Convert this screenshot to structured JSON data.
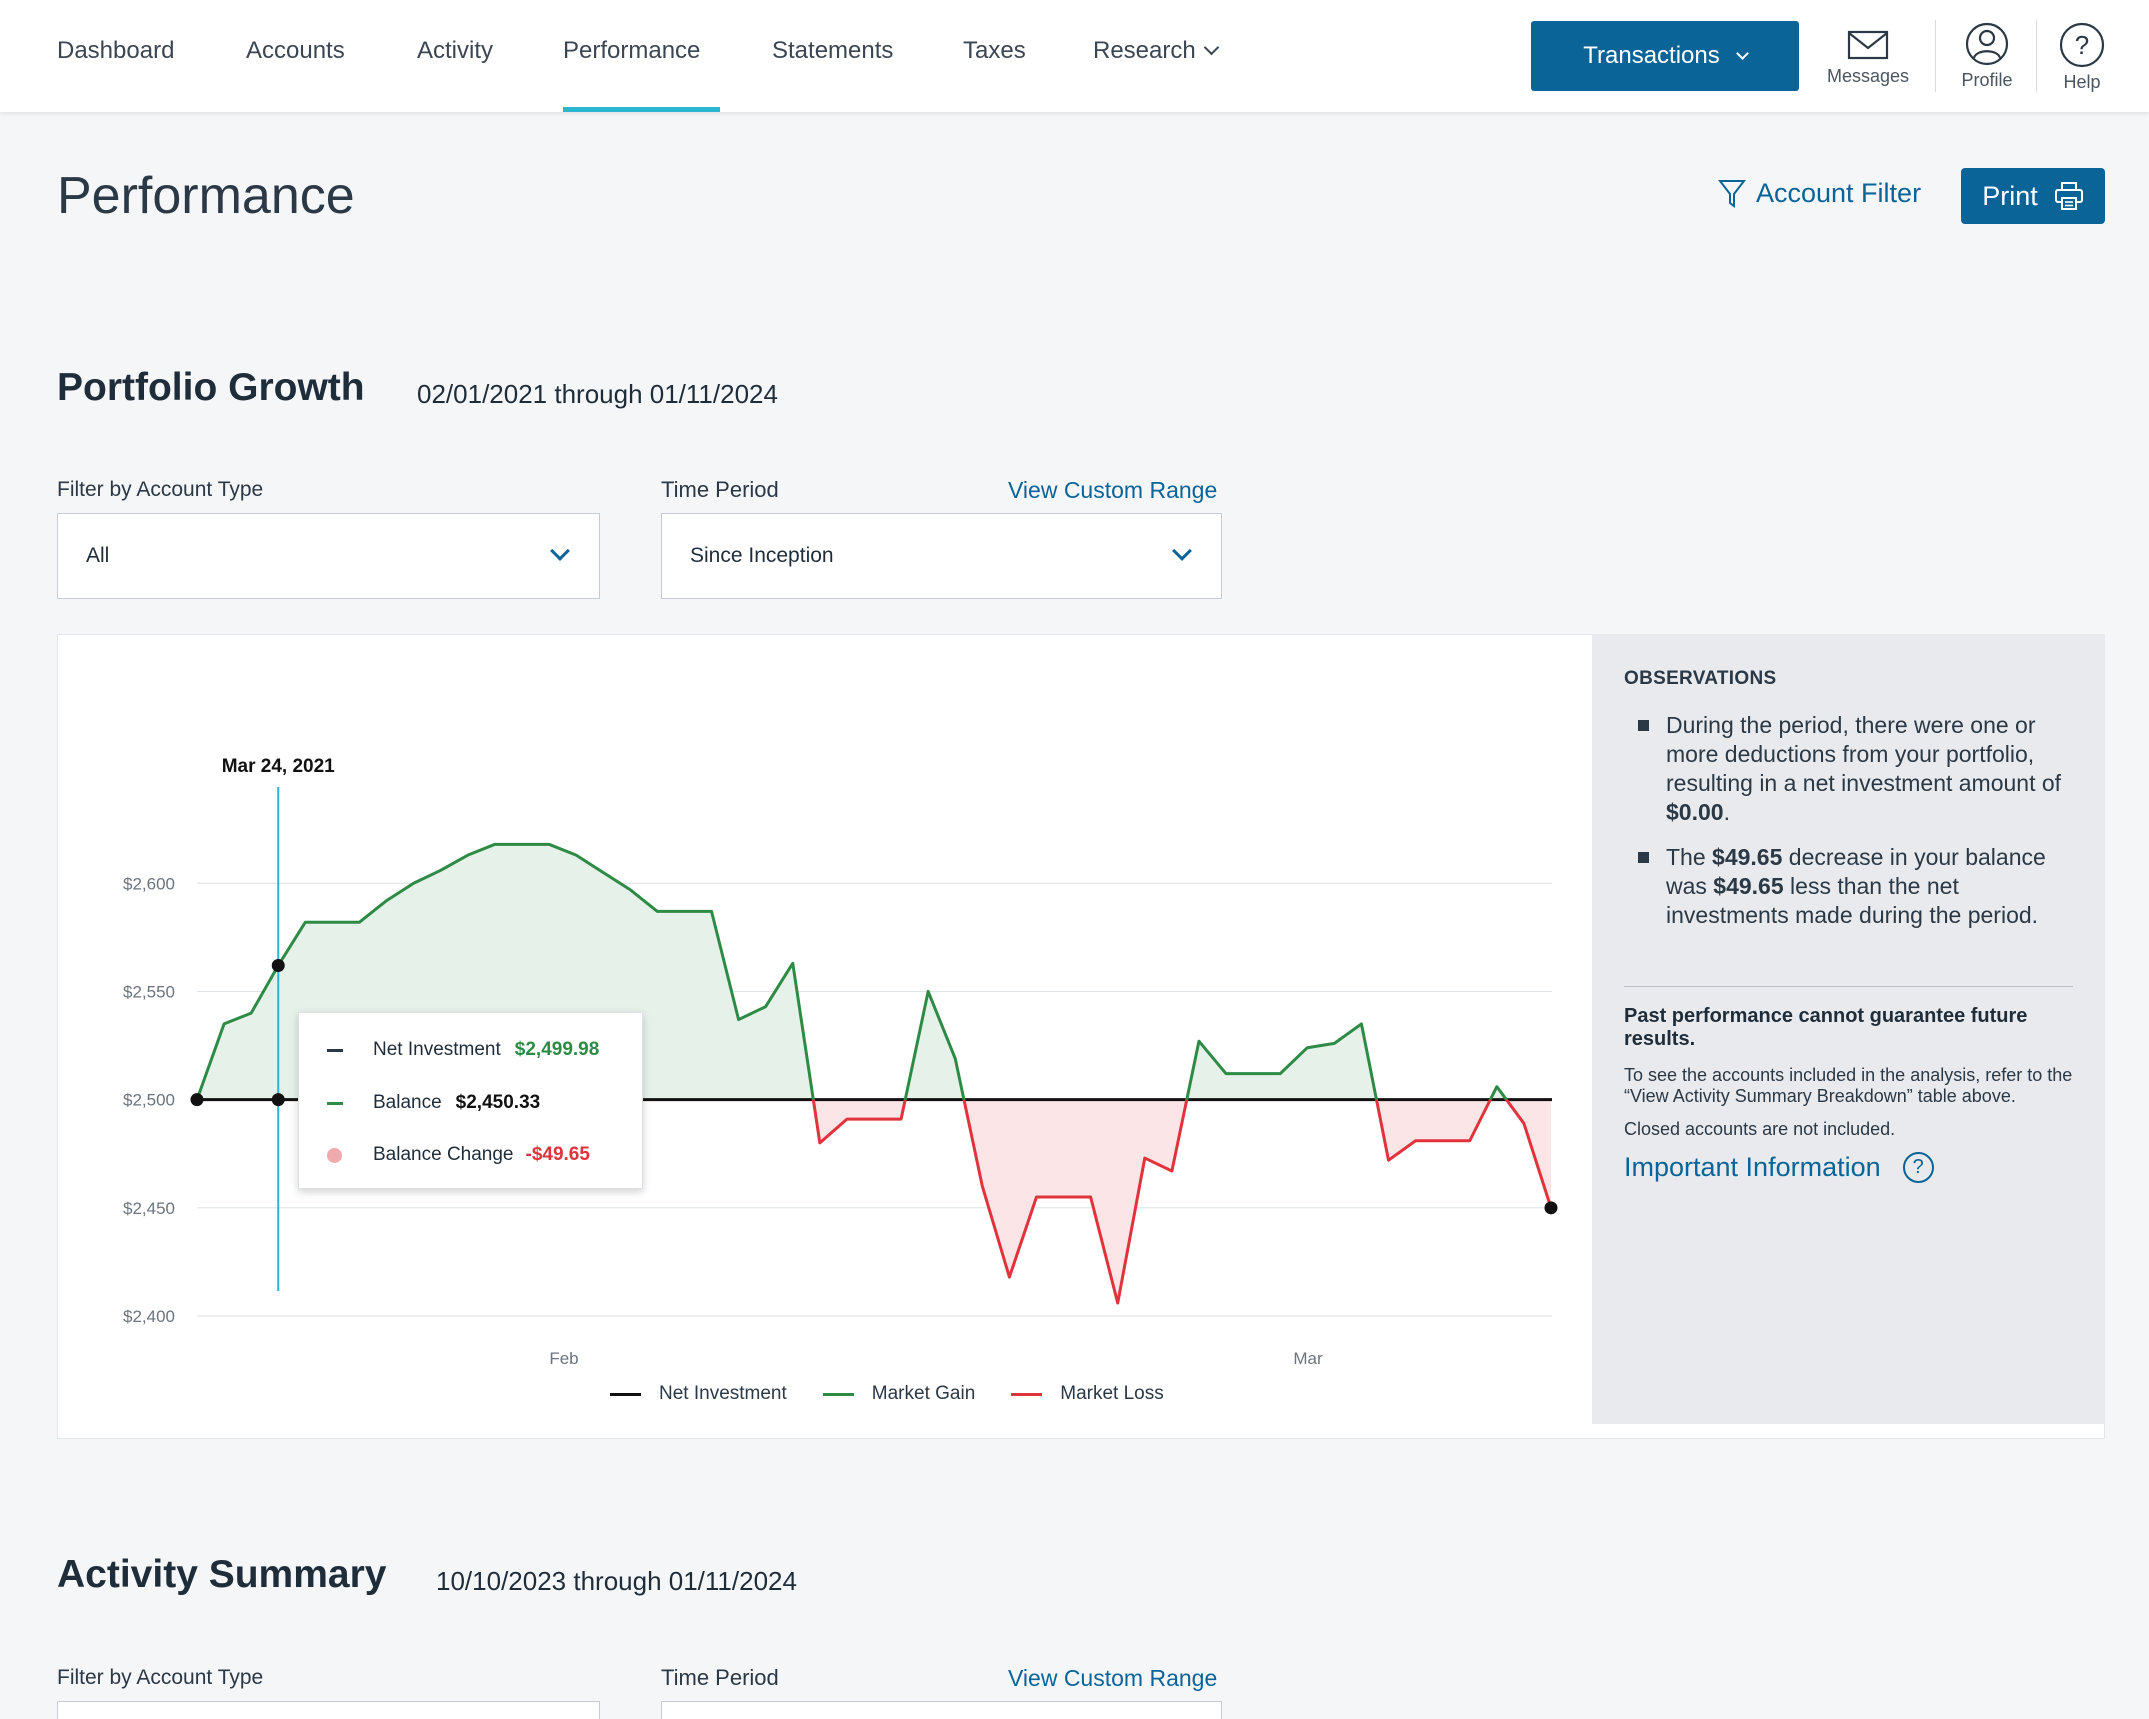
{
  "nav": {
    "tabs": [
      {
        "label": "Dashboard"
      },
      {
        "label": "Accounts"
      },
      {
        "label": "Activity"
      },
      {
        "label": "Performance"
      },
      {
        "label": "Statements"
      },
      {
        "label": "Taxes"
      },
      {
        "label": "Research"
      }
    ],
    "active_tab": "Performance",
    "transactions_label": "Transactions",
    "messages_label": "Messages",
    "profile_label": "Profile",
    "help_label": "Help"
  },
  "page": {
    "title": "Performance",
    "account_filter_label": "Account Filter",
    "print_label": "Print"
  },
  "portfolio_growth": {
    "title": "Portfolio Growth",
    "date_range": "02/01/2021 through 01/11/2024",
    "filter_label": "Filter by Account Type",
    "filter_value": "All",
    "period_label": "Time Period",
    "period_value": "Since Inception",
    "custom_range_link": "View Custom Range"
  },
  "tooltip": {
    "date": "Mar 24, 2021",
    "net_label": "Net Investment",
    "net_value": "$2,499.98",
    "balance_label": "Balance",
    "balance_value": "$2,450.33",
    "change_label": "Balance Change",
    "change_value": "-$49.65"
  },
  "colors": {
    "gain": "#2e8b45",
    "loss": "#e0333b",
    "net": "#111111",
    "accent": "#0a6497",
    "cursor": "#2ab5d1"
  },
  "chart_data": {
    "type": "area",
    "y_ticks": [
      "$2,600",
      "$2,550",
      "$2,500",
      "$2,450",
      "$2,400"
    ],
    "ylim": [
      2400,
      2620
    ],
    "x_ticks": [
      "Feb",
      "Mar"
    ],
    "net_investment": 2500,
    "balance": [
      2500,
      2535,
      2540,
      2562,
      2582,
      2582,
      2582,
      2592,
      2600,
      2606,
      2613,
      2618,
      2618,
      2618,
      2613,
      2605,
      2597,
      2587,
      2587,
      2587,
      2537,
      2543,
      2563,
      2480,
      2491,
      2491,
      2491,
      2550,
      2519,
      2460,
      2418,
      2455,
      2455,
      2455,
      2406,
      2473,
      2467,
      2527,
      2512,
      2512,
      2512,
      2524,
      2526,
      2535,
      2472,
      2481,
      2481,
      2481,
      2506,
      2489,
      2450
    ],
    "legend": [
      "Net Investment",
      "Market Gain",
      "Market Loss"
    ]
  },
  "observations": {
    "heading": "OBSERVATIONS",
    "item1_text_a": "During the period, there were one or more deductions from your portfolio, resulting in a net investment amount of ",
    "item1_bold": "$0.00",
    "item1_end": ".",
    "item2_a": "The ",
    "item2_b1": "$49.65",
    "item2_c": " decrease in your balance was ",
    "item2_b2": "$49.65",
    "item2_d": " less than the net investments made during the period.",
    "warning": "Past performance cannot guarantee future results.",
    "note1": "To see the accounts included in the analysis, refer to the “View Activity Summary Breakdown” table above.",
    "note2": "Closed accounts are not included.",
    "info_link": "Important Information"
  },
  "activity_summary": {
    "title": "Activity Summary",
    "date_range": "10/10/2023 through 01/11/2024",
    "filter_label": "Filter by Account Type",
    "period_label": "Time Period",
    "custom_range_link": "View Custom Range"
  }
}
